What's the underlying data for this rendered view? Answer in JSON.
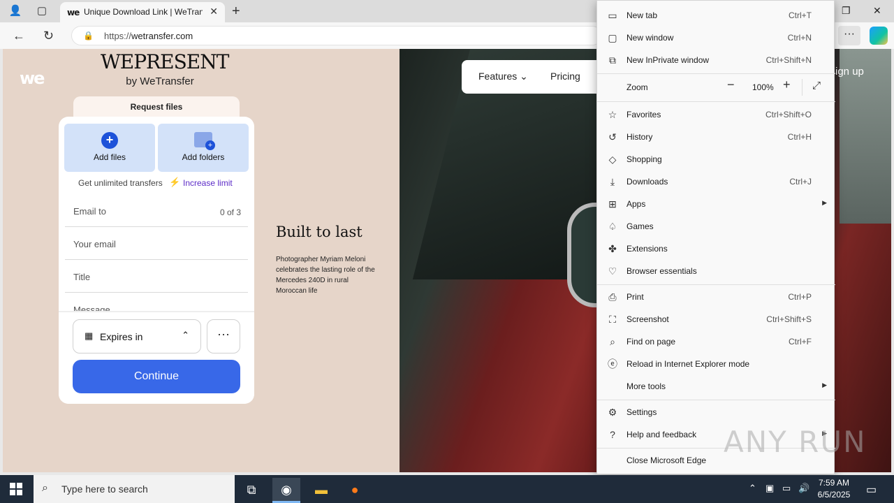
{
  "browser": {
    "tab_title": "Unique Download Link | WeTrans",
    "tab_favicon": "we",
    "url_prefix": "https://",
    "url_domain": "wetransfer.com"
  },
  "page": {
    "we_logo": "we",
    "wepresent_brand": "WEPRESENT",
    "wepresent_sub": "by WeTransfer",
    "request_files_tab": "Request files",
    "add_files": "Add files",
    "add_folders": "Add folders",
    "unlimited_text": "Get unlimited transfers",
    "increase_limit": "Increase limit",
    "email_to": "Email to",
    "email_count": "0 of 3",
    "your_email": "Your email",
    "title_field": "Title",
    "message_field": "Message",
    "expires_in": "Expires in",
    "continue": "Continue",
    "article_title": "Built to last",
    "article_desc": "Photographer Myriam Meloni celebrates the lasting role of the Mercedes 240D in rural Moroccan life",
    "nav_features": "Features",
    "nav_pricing": "Pricing",
    "sign_up": "Sign up"
  },
  "menu": {
    "items": [
      {
        "label": "New tab",
        "shortcut": "Ctrl+T",
        "icon": "new-tab-icon"
      },
      {
        "label": "New window",
        "shortcut": "Ctrl+N",
        "icon": "new-window-icon"
      },
      {
        "label": "New InPrivate window",
        "shortcut": "Ctrl+Shift+N",
        "icon": "inprivate-icon"
      },
      {
        "label": "Zoom",
        "shortcut": "",
        "icon": ""
      },
      {
        "label": "Favorites",
        "shortcut": "Ctrl+Shift+O",
        "icon": "star-icon"
      },
      {
        "label": "History",
        "shortcut": "Ctrl+H",
        "icon": "history-icon"
      },
      {
        "label": "Shopping",
        "shortcut": "",
        "icon": "tag-icon"
      },
      {
        "label": "Downloads",
        "shortcut": "Ctrl+J",
        "icon": "download-icon"
      },
      {
        "label": "Apps",
        "shortcut": "",
        "icon": "apps-icon"
      },
      {
        "label": "Games",
        "shortcut": "",
        "icon": "games-icon"
      },
      {
        "label": "Extensions",
        "shortcut": "",
        "icon": "puzzle-icon"
      },
      {
        "label": "Browser essentials",
        "shortcut": "",
        "icon": "heart-pulse-icon"
      },
      {
        "label": "Print",
        "shortcut": "Ctrl+P",
        "icon": "printer-icon"
      },
      {
        "label": "Screenshot",
        "shortcut": "Ctrl+Shift+S",
        "icon": "screenshot-icon"
      },
      {
        "label": "Find on page",
        "shortcut": "Ctrl+F",
        "icon": "find-icon"
      },
      {
        "label": "Reload in Internet Explorer mode",
        "shortcut": "",
        "icon": "ie-icon"
      },
      {
        "label": "More tools",
        "shortcut": "",
        "icon": ""
      },
      {
        "label": "Settings",
        "shortcut": "",
        "icon": "gear-icon"
      },
      {
        "label": "Help and feedback",
        "shortcut": "",
        "icon": "help-icon"
      },
      {
        "label": "Close Microsoft Edge",
        "shortcut": "",
        "icon": ""
      }
    ],
    "zoom_value": "100%"
  },
  "watermark": "ANY RUN",
  "taskbar": {
    "search_placeholder": "Type here to search",
    "time": "7:59 AM",
    "date": "6/5/2025"
  },
  "colors": {
    "accent": "#3868e8",
    "page_bg": "#e6d5c9",
    "increase_limit": "#5c2bc7"
  }
}
